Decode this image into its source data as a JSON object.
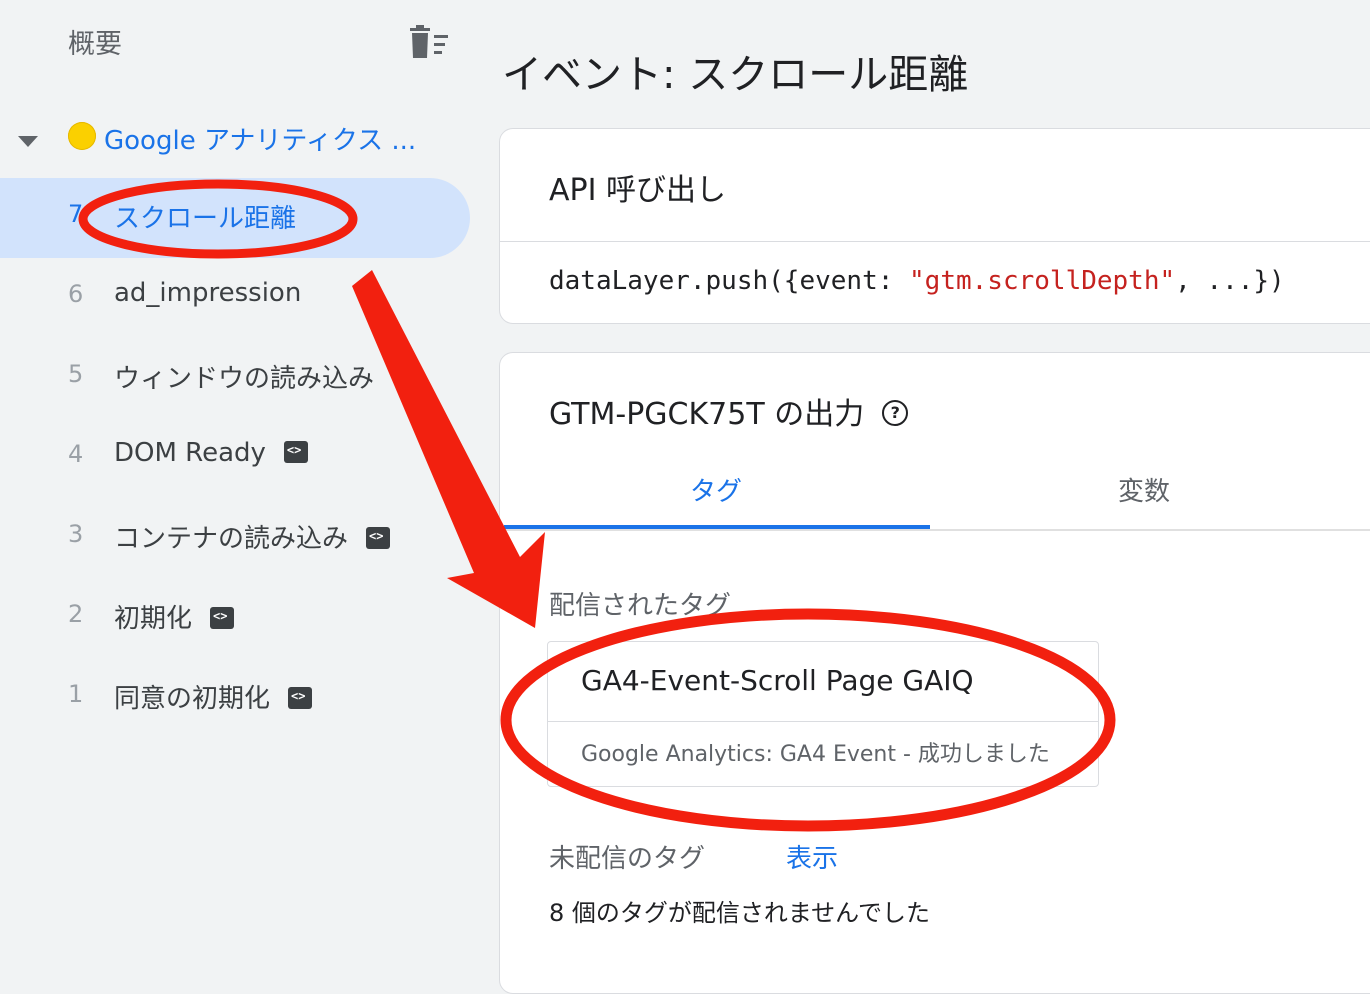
{
  "sidebar": {
    "summary_label": "概要",
    "clear_icon": "delete-sweep-icon",
    "container": {
      "name": "Google アナリティクス ...",
      "icon": "yellow-circle-icon",
      "expand_icon": "caret-down-icon"
    },
    "events": [
      {
        "number": "7",
        "label": "スクロール距離",
        "selected": true,
        "has_code_badge": false
      },
      {
        "number": "6",
        "label": "ad_impression",
        "selected": false,
        "has_code_badge": false
      },
      {
        "number": "5",
        "label": "ウィンドウの読み込み",
        "selected": false,
        "has_code_badge": false
      },
      {
        "number": "4",
        "label": "DOM Ready",
        "selected": false,
        "has_code_badge": true
      },
      {
        "number": "3",
        "label": "コンテナの読み込み",
        "selected": false,
        "has_code_badge": true
      },
      {
        "number": "2",
        "label": "初期化",
        "selected": false,
        "has_code_badge": true
      },
      {
        "number": "1",
        "label": "同意の初期化",
        "selected": false,
        "has_code_badge": true
      }
    ]
  },
  "main": {
    "title": "イベント: スクロール距離",
    "api_card": {
      "title": "API 呼び出し",
      "code_prefix": "dataLayer.push({event: ",
      "code_string": "\"gtm.scrollDepth\"",
      "code_suffix": ", ...})"
    },
    "output_card": {
      "title": "GTM-PGCK75T の出力",
      "help_icon": "help-circle-icon",
      "tabs": [
        {
          "label": "タグ",
          "active": true
        },
        {
          "label": "変数",
          "active": false
        }
      ],
      "fired_label": "配信されたタグ",
      "fired_tag": {
        "name": "GA4-Event-Scroll Page GAIQ",
        "status": "Google Analytics: GA4 Event - 成功しました"
      },
      "not_fired_label": "未配信のタグ",
      "show_link": "表示",
      "not_fired_count": "8 個のタグが配信されませんでした"
    }
  },
  "annotations": {
    "color": "#f2200f",
    "shapes": [
      "ellipse",
      "arrow",
      "ellipse"
    ]
  },
  "colors": {
    "accent": "#1a73e8",
    "selected_bg": "#d2e3fc",
    "code_string": "#c5221f",
    "annotation": "#f2200f"
  }
}
